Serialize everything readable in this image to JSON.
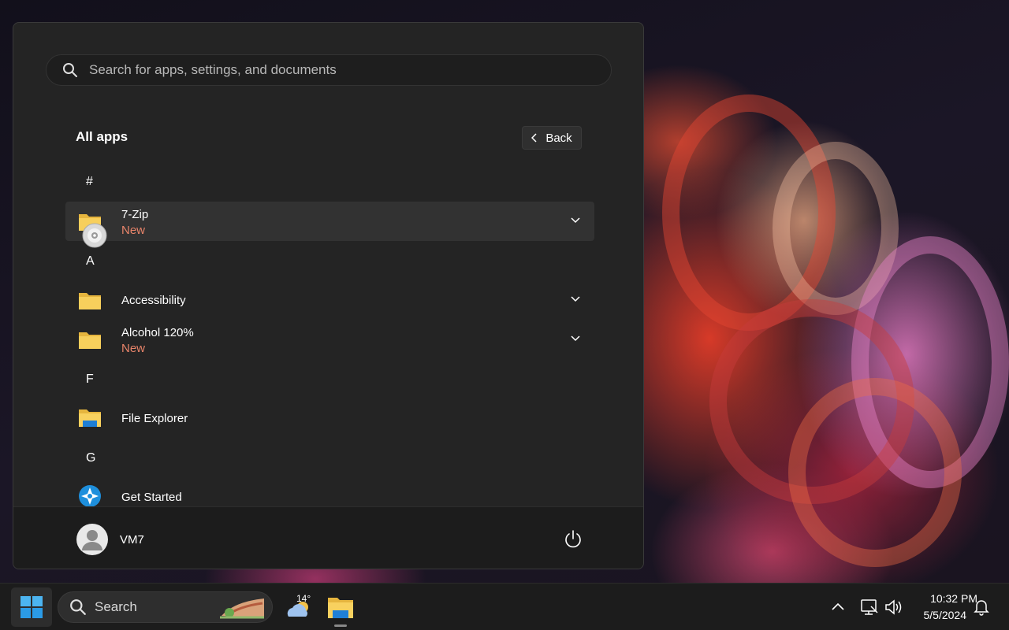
{
  "start_menu": {
    "search_placeholder": "Search for apps, settings, and documents",
    "all_apps_title": "All apps",
    "back_label": "Back",
    "sections": [
      {
        "letter": "#",
        "apps": [
          {
            "name": "7-Zip",
            "badge": "New",
            "icon": "folder-icon",
            "expandable": true
          }
        ]
      },
      {
        "letter": "A",
        "apps": [
          {
            "name": "Accessibility",
            "icon": "folder-icon",
            "expandable": true
          },
          {
            "name": "Alcohol 120%",
            "badge": "New",
            "icon": "folder-icon",
            "expandable": true
          }
        ]
      },
      {
        "letter": "F",
        "apps": [
          {
            "name": "File Explorer",
            "icon": "file-explorer-icon",
            "expandable": false
          }
        ]
      },
      {
        "letter": "G",
        "apps": [
          {
            "name": "Get Started",
            "icon": "get-started-icon",
            "expandable": false
          }
        ]
      }
    ],
    "user_name": "VM7"
  },
  "taskbar": {
    "search_label": "Search",
    "weather_temp": "14°",
    "clock_time": "10:32 PM",
    "clock_date": "5/5/2024"
  },
  "colors": {
    "accent_new": "#e8846a",
    "menu_bg": "#242424",
    "taskbar_bg": "#1c1c1c"
  }
}
